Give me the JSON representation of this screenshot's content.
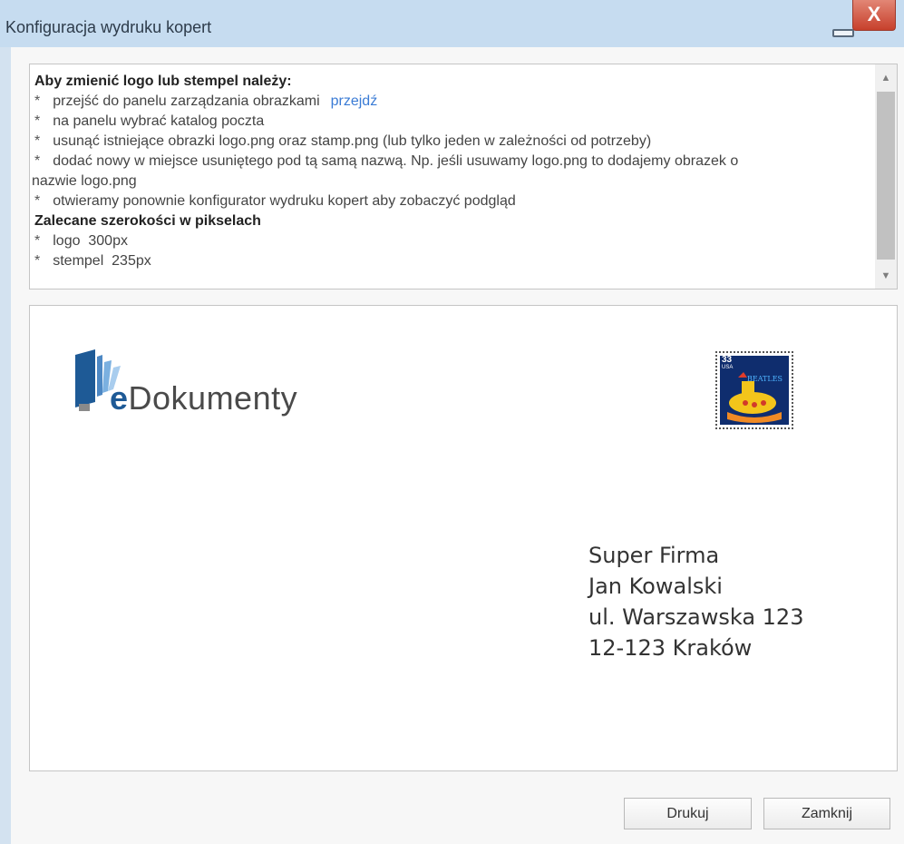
{
  "window": {
    "title": "Konfiguracja wydruku kopert",
    "close_glyph": "X"
  },
  "instructions": {
    "heading": "Aby zmienić logo lub stempel należy:",
    "bullet": "*",
    "items": [
      {
        "text": "przejść do panelu zarządzania obrazkami",
        "link": "przejdź"
      },
      {
        "text": "na panelu wybrać katalog poczta"
      },
      {
        "text": "usunąć istniejące obrazki logo.png oraz stamp.png (lub tylko jeden w zależności od potrzeby)"
      },
      {
        "text": "dodać nowy w miejsce usuniętego pod tą samą nazwą. Np. jeśli usuwamy logo.png to dodajemy obrazek o",
        "continuation": "nazwie logo.png"
      },
      {
        "text": "otwieramy ponownie konfigurator wydruku kopert aby zobaczyć podgląd"
      }
    ],
    "widths_heading": "Zalecane szerokości w pikselach",
    "widths": [
      {
        "text": "logo  300px"
      },
      {
        "text": "stempel  235px"
      }
    ]
  },
  "preview": {
    "logo": {
      "prefix": "e",
      "name": "Dokumenty"
    },
    "stamp": {
      "value": "33",
      "country": "USA",
      "band": "BEATLES"
    },
    "address": [
      "Super Firma",
      "Jan Kowalski",
      "ul. Warszawska 123",
      "12-123 Kraków"
    ]
  },
  "buttons": {
    "print": "Drukuj",
    "close": "Zamknij"
  },
  "colors": {
    "titlebar": "#c6dcf0",
    "close_button": "#c7402c",
    "link": "#3a7bd5",
    "logo_blue": "#1e5a96"
  }
}
